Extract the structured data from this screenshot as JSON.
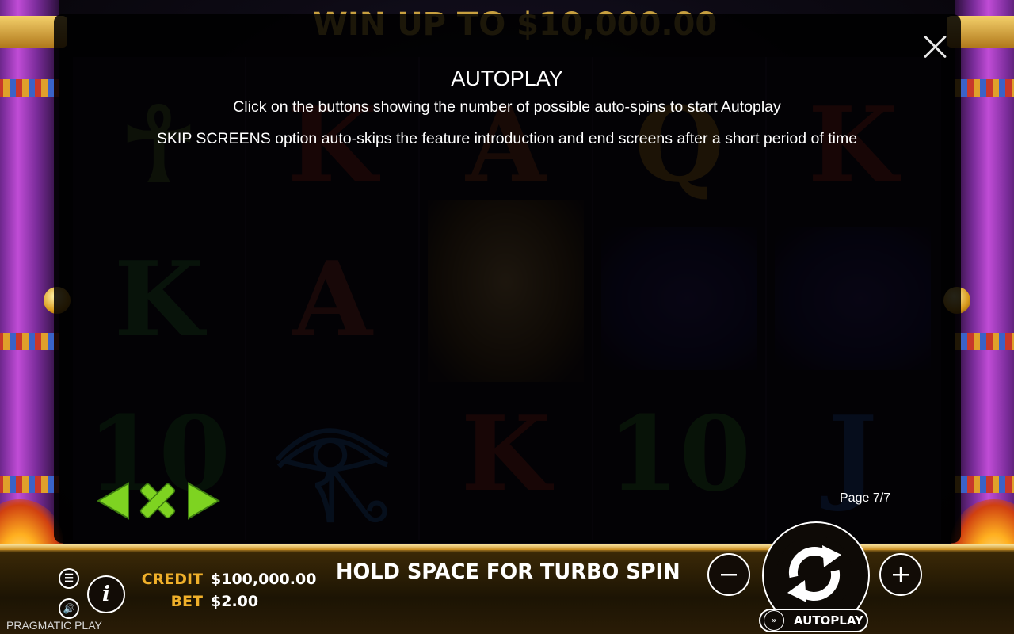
{
  "game": {
    "banner": "WIN UP TO $10,000.00",
    "reels": [
      [
        "☥",
        "K",
        "10"
      ],
      [
        "K",
        "A",
        "𓂀"
      ],
      [
        "A",
        "",
        "K"
      ],
      [
        "Q",
        "",
        "10"
      ],
      [
        "K",
        "",
        "J"
      ]
    ]
  },
  "help": {
    "title": "AUTOPLAY",
    "lines": [
      "Click on the buttons showing the number of possible auto-spins to start Autoplay",
      "SKIP SCREENS option auto-skips the feature introduction and end screens after a short period of time"
    ],
    "page": "Page 7/7"
  },
  "bottom_bar": {
    "credit_label": "CREDIT",
    "credit_value": "$100,000.00",
    "bet_label": "BET",
    "bet_value": "$2.00",
    "turbo_message": "HOLD SPACE FOR TURBO SPIN",
    "autoplay_label": "AUTOPLAY",
    "brand": "PRAGMATIC PLAY"
  },
  "icons": {
    "prev": "left-arrow-icon",
    "close_help": "x-icon",
    "next": "right-arrow-icon",
    "spin": "spin-arrows-icon",
    "menu": "menu-icon",
    "sound": "speaker-icon",
    "info": "info-icon"
  },
  "colors": {
    "accent_green": "#7ed321",
    "label_gold": "#f0b02a",
    "overlay": "#000000",
    "text": "#ffffff"
  }
}
